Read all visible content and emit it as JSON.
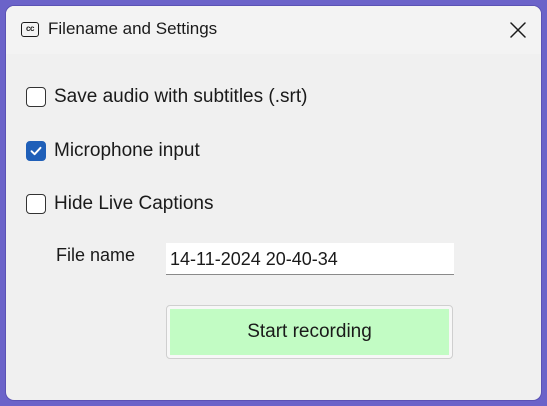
{
  "window": {
    "title": "Filename and Settings",
    "app_icon_text": "cc",
    "close_icon": "close-icon"
  },
  "options": [
    {
      "label": "Save audio with subtitles (.srt)",
      "checked": false
    },
    {
      "label": "Microphone input",
      "checked": true
    },
    {
      "label": "Hide Live Captions",
      "checked": false
    }
  ],
  "file": {
    "label": "File name",
    "value": "14-11-2024 20-40-34"
  },
  "start_button": {
    "label": "Start recording",
    "color": "#c2fcc4"
  },
  "colors": {
    "accent": "#1f5fb8",
    "desktop": "#6b63c9"
  }
}
